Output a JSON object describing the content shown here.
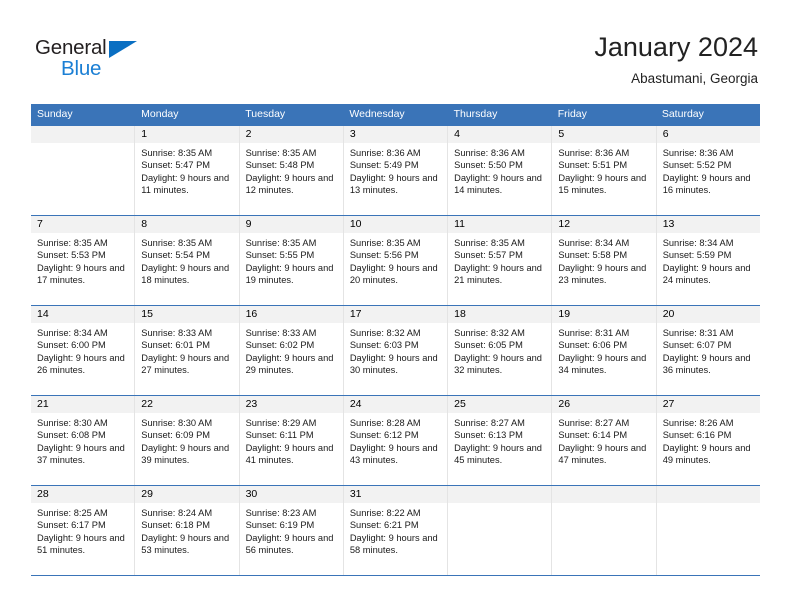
{
  "brand": {
    "name_top": "General",
    "name_bottom": "Blue",
    "accent_color": "#1b7fd4",
    "triangle_color": "#0a6fc2"
  },
  "header": {
    "title": "January 2024",
    "subtitle": "Abastumani, Georgia"
  },
  "calendar": {
    "header_color": "#3a74b8",
    "weekdays": [
      "Sunday",
      "Monday",
      "Tuesday",
      "Wednesday",
      "Thursday",
      "Friday",
      "Saturday"
    ],
    "labels": {
      "sunrise": "Sunrise:",
      "sunset": "Sunset:",
      "daylight": "Daylight:"
    },
    "weeks": [
      [
        {
          "day": "",
          "sunrise": "",
          "sunset": "",
          "daylight": ""
        },
        {
          "day": "1",
          "sunrise": "Sunrise: 8:35 AM",
          "sunset": "Sunset: 5:47 PM",
          "daylight": "Daylight: 9 hours and 11 minutes."
        },
        {
          "day": "2",
          "sunrise": "Sunrise: 8:35 AM",
          "sunset": "Sunset: 5:48 PM",
          "daylight": "Daylight: 9 hours and 12 minutes."
        },
        {
          "day": "3",
          "sunrise": "Sunrise: 8:36 AM",
          "sunset": "Sunset: 5:49 PM",
          "daylight": "Daylight: 9 hours and 13 minutes."
        },
        {
          "day": "4",
          "sunrise": "Sunrise: 8:36 AM",
          "sunset": "Sunset: 5:50 PM",
          "daylight": "Daylight: 9 hours and 14 minutes."
        },
        {
          "day": "5",
          "sunrise": "Sunrise: 8:36 AM",
          "sunset": "Sunset: 5:51 PM",
          "daylight": "Daylight: 9 hours and 15 minutes."
        },
        {
          "day": "6",
          "sunrise": "Sunrise: 8:36 AM",
          "sunset": "Sunset: 5:52 PM",
          "daylight": "Daylight: 9 hours and 16 minutes."
        }
      ],
      [
        {
          "day": "7",
          "sunrise": "Sunrise: 8:35 AM",
          "sunset": "Sunset: 5:53 PM",
          "daylight": "Daylight: 9 hours and 17 minutes."
        },
        {
          "day": "8",
          "sunrise": "Sunrise: 8:35 AM",
          "sunset": "Sunset: 5:54 PM",
          "daylight": "Daylight: 9 hours and 18 minutes."
        },
        {
          "day": "9",
          "sunrise": "Sunrise: 8:35 AM",
          "sunset": "Sunset: 5:55 PM",
          "daylight": "Daylight: 9 hours and 19 minutes."
        },
        {
          "day": "10",
          "sunrise": "Sunrise: 8:35 AM",
          "sunset": "Sunset: 5:56 PM",
          "daylight": "Daylight: 9 hours and 20 minutes."
        },
        {
          "day": "11",
          "sunrise": "Sunrise: 8:35 AM",
          "sunset": "Sunset: 5:57 PM",
          "daylight": "Daylight: 9 hours and 21 minutes."
        },
        {
          "day": "12",
          "sunrise": "Sunrise: 8:34 AM",
          "sunset": "Sunset: 5:58 PM",
          "daylight": "Daylight: 9 hours and 23 minutes."
        },
        {
          "day": "13",
          "sunrise": "Sunrise: 8:34 AM",
          "sunset": "Sunset: 5:59 PM",
          "daylight": "Daylight: 9 hours and 24 minutes."
        }
      ],
      [
        {
          "day": "14",
          "sunrise": "Sunrise: 8:34 AM",
          "sunset": "Sunset: 6:00 PM",
          "daylight": "Daylight: 9 hours and 26 minutes."
        },
        {
          "day": "15",
          "sunrise": "Sunrise: 8:33 AM",
          "sunset": "Sunset: 6:01 PM",
          "daylight": "Daylight: 9 hours and 27 minutes."
        },
        {
          "day": "16",
          "sunrise": "Sunrise: 8:33 AM",
          "sunset": "Sunset: 6:02 PM",
          "daylight": "Daylight: 9 hours and 29 minutes."
        },
        {
          "day": "17",
          "sunrise": "Sunrise: 8:32 AM",
          "sunset": "Sunset: 6:03 PM",
          "daylight": "Daylight: 9 hours and 30 minutes."
        },
        {
          "day": "18",
          "sunrise": "Sunrise: 8:32 AM",
          "sunset": "Sunset: 6:05 PM",
          "daylight": "Daylight: 9 hours and 32 minutes."
        },
        {
          "day": "19",
          "sunrise": "Sunrise: 8:31 AM",
          "sunset": "Sunset: 6:06 PM",
          "daylight": "Daylight: 9 hours and 34 minutes."
        },
        {
          "day": "20",
          "sunrise": "Sunrise: 8:31 AM",
          "sunset": "Sunset: 6:07 PM",
          "daylight": "Daylight: 9 hours and 36 minutes."
        }
      ],
      [
        {
          "day": "21",
          "sunrise": "Sunrise: 8:30 AM",
          "sunset": "Sunset: 6:08 PM",
          "daylight": "Daylight: 9 hours and 37 minutes."
        },
        {
          "day": "22",
          "sunrise": "Sunrise: 8:30 AM",
          "sunset": "Sunset: 6:09 PM",
          "daylight": "Daylight: 9 hours and 39 minutes."
        },
        {
          "day": "23",
          "sunrise": "Sunrise: 8:29 AM",
          "sunset": "Sunset: 6:11 PM",
          "daylight": "Daylight: 9 hours and 41 minutes."
        },
        {
          "day": "24",
          "sunrise": "Sunrise: 8:28 AM",
          "sunset": "Sunset: 6:12 PM",
          "daylight": "Daylight: 9 hours and 43 minutes."
        },
        {
          "day": "25",
          "sunrise": "Sunrise: 8:27 AM",
          "sunset": "Sunset: 6:13 PM",
          "daylight": "Daylight: 9 hours and 45 minutes."
        },
        {
          "day": "26",
          "sunrise": "Sunrise: 8:27 AM",
          "sunset": "Sunset: 6:14 PM",
          "daylight": "Daylight: 9 hours and 47 minutes."
        },
        {
          "day": "27",
          "sunrise": "Sunrise: 8:26 AM",
          "sunset": "Sunset: 6:16 PM",
          "daylight": "Daylight: 9 hours and 49 minutes."
        }
      ],
      [
        {
          "day": "28",
          "sunrise": "Sunrise: 8:25 AM",
          "sunset": "Sunset: 6:17 PM",
          "daylight": "Daylight: 9 hours and 51 minutes."
        },
        {
          "day": "29",
          "sunrise": "Sunrise: 8:24 AM",
          "sunset": "Sunset: 6:18 PM",
          "daylight": "Daylight: 9 hours and 53 minutes."
        },
        {
          "day": "30",
          "sunrise": "Sunrise: 8:23 AM",
          "sunset": "Sunset: 6:19 PM",
          "daylight": "Daylight: 9 hours and 56 minutes."
        },
        {
          "day": "31",
          "sunrise": "Sunrise: 8:22 AM",
          "sunset": "Sunset: 6:21 PM",
          "daylight": "Daylight: 9 hours and 58 minutes."
        },
        {
          "day": "",
          "sunrise": "",
          "sunset": "",
          "daylight": ""
        },
        {
          "day": "",
          "sunrise": "",
          "sunset": "",
          "daylight": ""
        },
        {
          "day": "",
          "sunrise": "",
          "sunset": "",
          "daylight": ""
        }
      ]
    ]
  }
}
